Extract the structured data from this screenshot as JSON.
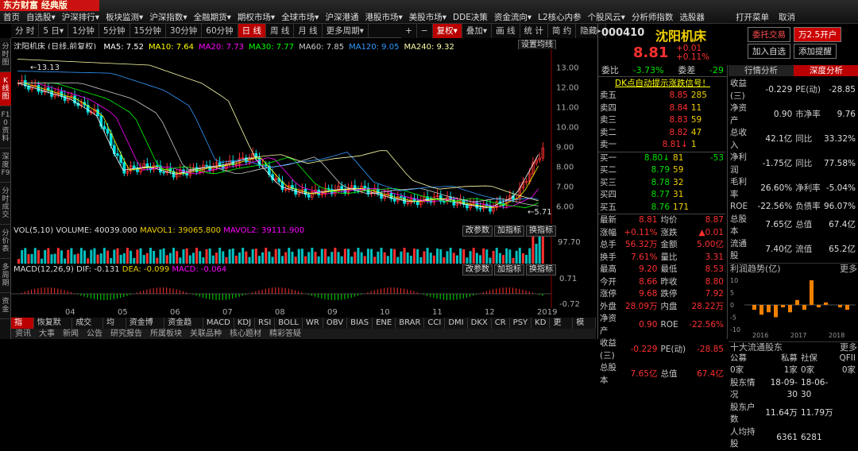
{
  "app": {
    "logo_text": "东方财富 经典版",
    "menu": [
      "首页",
      "自选股▾",
      "沪深排行▾",
      "板块监测▾",
      "沪深指数▾",
      "全融期货▾",
      "期权市场▾",
      "全球市场▾",
      "沪深港通",
      "港股市场▾",
      "美股市场▾",
      "DDE决策",
      "资金流向▾",
      "L2核心内参",
      "个股风云▾",
      "分析师指数",
      "选股器"
    ],
    "right_menu": [
      "打开菜单",
      "取消"
    ]
  },
  "periods": [
    "分 时",
    "5 日▾",
    "1分钟",
    "5分钟",
    "15分钟",
    "30分钟",
    "60分钟",
    "日 线",
    "周 线",
    "月 线",
    "更多周期▾"
  ],
  "toolbar_right": [
    "+",
    "−",
    "复权▾",
    "叠加▾",
    "画 线",
    "统 计",
    "简 约",
    "隐藏▸"
  ],
  "left_tabs": [
    "分时图",
    "K线图",
    "F10资料",
    "深度F9",
    "分时成交",
    "分价表",
    "多周期",
    "资金"
  ],
  "chart_header": {
    "name": "沈阳机床 (日线,前复权)",
    "ma": [
      {
        "label": "MA5: 7.52",
        "color": "#ffffff"
      },
      {
        "label": "MA10: 7.64",
        "color": "#ffff00"
      },
      {
        "label": "MA20: 7.73",
        "color": "#ff00ff"
      },
      {
        "label": "MA30: 7.77",
        "color": "#00ff00"
      },
      {
        "label": "MA60: 7.85",
        "color": "#cccccc"
      },
      {
        "label": "MA120: 9.05",
        "color": "#3399ff"
      },
      {
        "label": "MA240: 9.32",
        "color": "#ffffaa"
      }
    ],
    "settings": "设置均线"
  },
  "chart_data": {
    "type": "line",
    "title": "",
    "xlabel": "",
    "ylabel": "",
    "x": [
      "04",
      "05",
      "06",
      "07",
      "08",
      "09",
      "10",
      "11",
      "12",
      "2019"
    ],
    "ylim": [
      5.5,
      13.5
    ],
    "yticks": [
      13.0,
      12.0,
      11.0,
      10.0,
      9.0,
      8.0,
      7.0,
      6.0
    ],
    "high_label": "13.13",
    "low_label": "5.71",
    "close": [
      12.2,
      11.8,
      11.4,
      10.6,
      7.8,
      8.0,
      7.6,
      7.9,
      8.1,
      8.5,
      7.0,
      6.6,
      6.8,
      6.9,
      6.5,
      6.2,
      6.4,
      6.1,
      5.9,
      6.5,
      8.9
    ]
  },
  "volume": {
    "header": "VOL(5,10)",
    "value": "VOLUME: 40039.000",
    "mavol1": "MAVOL1: 39065.800",
    "mavol2": "MAVOL2: 39111.900",
    "ytick": "97.70",
    "buttons": [
      "改参数",
      "加指标",
      "换指标"
    ]
  },
  "macd": {
    "header": "MACD(12,26,9)",
    "dif": "DIF: -0.131",
    "dea": "DEA: -0.099",
    "macd": "MACD: -0.064",
    "yticks": [
      "0.71",
      "-0.72"
    ],
    "buttons": [
      "改参数",
      "加指标",
      "换指标"
    ]
  },
  "bottom_tabs": [
    "指标",
    "恢复默认",
    "成交量",
    "均线",
    "资金博弈",
    "资金趋势",
    "MACD",
    "KDJ",
    "RSI",
    "BOLL",
    "WR",
    "OBV",
    "BIAS",
    "ENE",
    "BRAR",
    "CCI",
    "DMI",
    "DKX",
    "CR",
    "PSY",
    "KD",
    "更多",
    "模板"
  ],
  "bottom_tabs2": [
    "资讯",
    "大事",
    "新闻",
    "公告",
    "研究报告",
    "所属板块",
    "关联品种",
    "核心题材",
    "精彩答疑"
  ],
  "stock": {
    "code": "000410",
    "name": "沈阳机床",
    "price": "8.81",
    "change": "+0.01",
    "pct": "+0.11%",
    "buttons": [
      "委托交易",
      "万2.5开户",
      "加入自选",
      "添加提醒"
    ]
  },
  "order_book": {
    "webi_label": "委比",
    "webi": "-3.73%",
    "weica_label": "委差",
    "weica": "-29",
    "signal": "DK点自动提示涨跌信号！",
    "sells": [
      {
        "l": "卖五",
        "p": "8.85",
        "v": "285"
      },
      {
        "l": "卖四",
        "p": "8.84",
        "v": "11"
      },
      {
        "l": "卖三",
        "p": "8.83",
        "v": "59"
      },
      {
        "l": "卖二",
        "p": "8.82",
        "v": "47"
      },
      {
        "l": "卖一",
        "p": "8.81↓",
        "v": "1"
      }
    ],
    "buys": [
      {
        "l": "买一",
        "p": "8.80↓",
        "v": "81",
        "d": "-53"
      },
      {
        "l": "买二",
        "p": "8.79",
        "v": "59",
        "d": ""
      },
      {
        "l": "买三",
        "p": "8.78",
        "v": "32",
        "d": ""
      },
      {
        "l": "买四",
        "p": "8.77",
        "v": "31",
        "d": ""
      },
      {
        "l": "买五",
        "p": "8.76",
        "v": "171",
        "d": ""
      }
    ]
  },
  "stats": [
    [
      "最新",
      "8.81",
      "均价",
      "8.87"
    ],
    [
      "涨幅",
      "+0.11%",
      "涨跌",
      "▲0.01"
    ],
    [
      "总手",
      "56.32万",
      "金额",
      "5.00亿"
    ],
    [
      "换手",
      "7.61%",
      "量比",
      "3.31"
    ],
    [
      "最高",
      "9.20",
      "最低",
      "8.53"
    ],
    [
      "今开",
      "8.66",
      "昨收",
      "8.80"
    ],
    [
      "涨停",
      "9.68",
      "跌停",
      "7.92"
    ],
    [
      "外盘",
      "28.09万",
      "内盘",
      "28.22万"
    ],
    [
      "净资产",
      "0.90",
      "ROE",
      "-22.56%"
    ],
    [
      "收益(三)",
      "-0.229",
      "PE(动)",
      "-28.85"
    ],
    [
      "总股本",
      "7.65亿",
      "总值",
      "67.4亿"
    ]
  ],
  "tabs_right": [
    "行情分析",
    "深度分析"
  ],
  "fin": [
    [
      "收益(三)",
      "-0.229",
      "PE(动)",
      "-28.85"
    ],
    [
      "净资产",
      "0.90",
      "市净率",
      "9.76"
    ],
    [
      "总收入",
      "42.1亿",
      "同比",
      "33.32%"
    ],
    [
      "净利润",
      "-1.75亿",
      "同比",
      "77.58%"
    ],
    [
      "毛利率",
      "26.60%",
      "净利率",
      "-5.04%"
    ],
    [
      "ROE",
      "-22.56%",
      "负债率",
      "96.07%"
    ],
    [
      "总股本",
      "7.65亿",
      "总值",
      "67.4亿"
    ],
    [
      "流通股",
      "7.40亿",
      "流值",
      "65.2亿"
    ]
  ],
  "profit_chart": {
    "title": "利润趋势(亿)",
    "more": "更多",
    "yticks": [
      "10",
      "5",
      "0",
      "-5",
      "-10"
    ],
    "years": [
      "2016",
      "2017",
      "2018"
    ],
    "values": [
      -2,
      -4,
      -3,
      -5,
      -1,
      -3,
      2,
      -2,
      10,
      -1,
      1,
      0,
      -1,
      -2
    ]
  },
  "holders": {
    "title": "十大流通股东",
    "more": "更多",
    "cats": [
      "公募",
      "私募",
      "社保",
      "QFII"
    ],
    "counts": [
      "0家",
      "1家",
      "0家",
      "0家"
    ],
    "row1": [
      "股东情况",
      "18-09-30",
      "18-06-30"
    ],
    "row2": [
      "股东户数",
      "11.64万",
      "11.79万"
    ],
    "row3": [
      "人均持股",
      "6361",
      "6281"
    ]
  }
}
